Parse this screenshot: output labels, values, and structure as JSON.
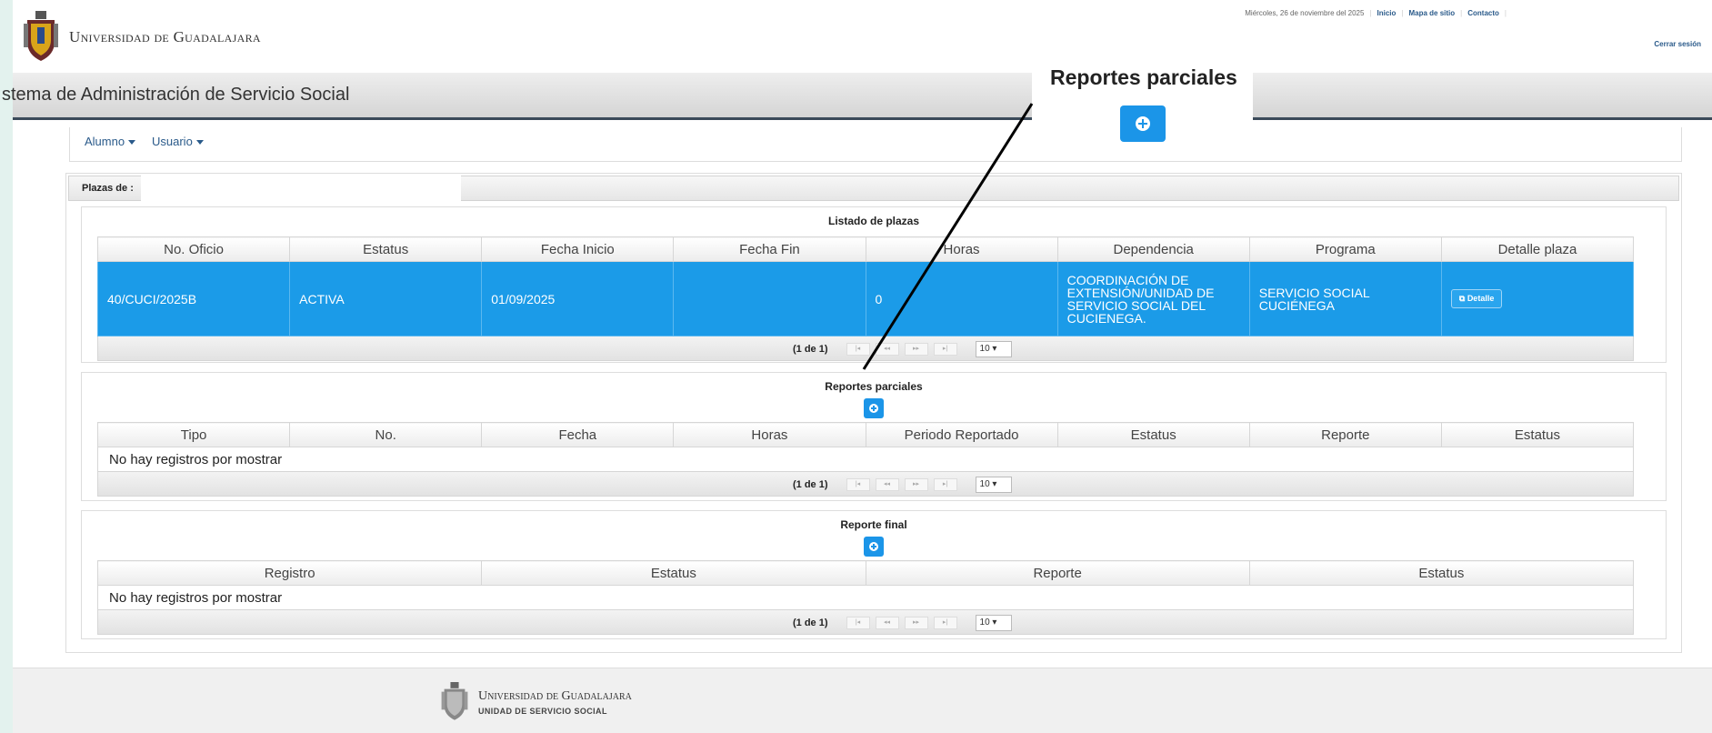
{
  "header": {
    "brand": "Universidad de Guadalajara",
    "date": "Miércoles, 26 de noviembre del 2025",
    "links": [
      "Inicio",
      "Mapa de sitio",
      "Contacto"
    ],
    "logout": "Cerrar sesión",
    "system_title": "stema de Administración de Servicio Social"
  },
  "menu": {
    "alumno": "Alumno",
    "usuario": "Usuario"
  },
  "panel": {
    "title": "Plazas de :"
  },
  "plazas": {
    "title": "Listado de plazas",
    "columns": [
      "No. Oficio",
      "Estatus",
      "Fecha Inicio",
      "Fecha Fin",
      "Horas",
      "Dependencia",
      "Programa",
      "Detalle plaza"
    ],
    "row": {
      "oficio": "40/CUCI/2025B",
      "estatus": "ACTIVA",
      "fecha_inicio": "01/09/2025",
      "fecha_fin": "",
      "horas": "0",
      "dependencia": "COORDINACIÓN DE EXTENSIÓN/UNIDAD DE SERVICIO SOCIAL DEL CUCIENEGA.",
      "programa": "SERVICIO SOCIAL CUCIÉNEGA",
      "detalle_button": "Detalle"
    },
    "pager": {
      "count": "(1 de 1)",
      "per_page": "10"
    }
  },
  "reportes_parciales": {
    "title": "Reportes parciales",
    "columns": [
      "Tipo",
      "No.",
      "Fecha",
      "Horas",
      "Periodo Reportado",
      "Estatus",
      "Reporte",
      "Estatus"
    ],
    "empty": "No hay registros por mostrar",
    "pager": {
      "count": "(1 de 1)",
      "per_page": "10"
    }
  },
  "reporte_final": {
    "title": "Reporte final",
    "columns": [
      "Registro",
      "Estatus",
      "Reporte",
      "Estatus"
    ],
    "empty": "No hay registros por mostrar",
    "pager": {
      "count": "(1 de 1)",
      "per_page": "10"
    }
  },
  "callout": {
    "title": "Reportes parciales",
    "icon": "plus-circle-icon"
  },
  "footer": {
    "brand": "Universidad de Guadalajara",
    "unit": "UNIDAD DE SERVICIO SOCIAL"
  },
  "colors": {
    "accent": "#1b9be8",
    "link": "#2a5a8a",
    "titlebar_border": "#3b4a5a"
  }
}
